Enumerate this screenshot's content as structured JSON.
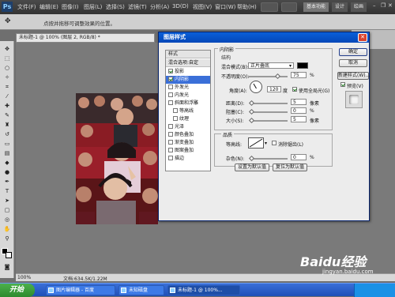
{
  "app": {
    "logo": "Ps"
  },
  "menu": [
    "文件(F)",
    "编辑(E)",
    "图像(I)",
    "图层(L)",
    "选择(S)",
    "滤镜(T)",
    "分析(A)",
    "3D(D)",
    "视图(V)",
    "窗口(W)",
    "帮助(H)"
  ],
  "workspaces": [
    "基本功能",
    "设计",
    "绘画"
  ],
  "options": {
    "hint": "点按并拖移可调整效果的位置。"
  },
  "document": {
    "tab": "未标题-1 @ 100% (图层 2, RGB/8) *",
    "zoom": "100%",
    "doc_size": "文档:634.5K/1.22M"
  },
  "dialog": {
    "title": "图层样式",
    "close_label": "✕",
    "style_list": [
      {
        "label": "样式",
        "type": "header"
      },
      {
        "label": "混合选项:自定",
        "type": "header"
      },
      {
        "label": "投影",
        "checked": true
      },
      {
        "label": "内阴影",
        "checked": true,
        "selected": true
      },
      {
        "label": "外发光",
        "checked": false
      },
      {
        "label": "内发光",
        "checked": false
      },
      {
        "label": "斜面和浮雕",
        "checked": false
      },
      {
        "label": "等高线",
        "checked": false
      },
      {
        "label": "纹理",
        "checked": false
      },
      {
        "label": "光泽",
        "checked": false
      },
      {
        "label": "颜色叠加",
        "checked": false
      },
      {
        "label": "渐变叠加",
        "checked": false
      },
      {
        "label": "图案叠加",
        "checked": false
      },
      {
        "label": "描边",
        "checked": false
      }
    ],
    "panel_title": "内阴影",
    "structure": {
      "legend": "结构",
      "blend_mode_label": "混合模式(B):",
      "blend_mode_value": "正片叠底",
      "blend_color": "#000000",
      "opacity_label": "不透明度(O):",
      "opacity_value": "75",
      "opacity_unit": "%",
      "opacity_fraction": 0.75,
      "angle_label": "角度(A):",
      "angle_value": "120",
      "angle_unit": "度",
      "global_light_label": "使用全局光(G)",
      "global_light_checked": true,
      "distance_label": "距离(D):",
      "distance_value": "5",
      "distance_unit": "像素",
      "choke_label": "阻塞(C):",
      "choke_value": "0",
      "choke_unit": "%",
      "size_label": "大小(S):",
      "size_value": "5",
      "size_unit": "像素"
    },
    "quality": {
      "legend": "品质",
      "contour_label": "等高线:",
      "antialias_label": "消除锯齿(L)",
      "antialias_checked": false,
      "noise_label": "杂色(N):",
      "noise_value": "0",
      "noise_unit": "%"
    },
    "set_default": "设置为默认值",
    "reset_default": "复位为默认值",
    "ok": "确定",
    "cancel": "取消",
    "new_style": "新建样式(W)...",
    "preview_label": "预览(V)",
    "preview_checked": true
  },
  "taskbar": {
    "start": "开始",
    "items": [
      "图片编辑器 - 百度",
      "未知磁盘",
      "未标题-1 @ 100%..."
    ],
    "active_index": 2
  },
  "watermark": {
    "brand": "Baidu经验",
    "url": "jingyan.baidu.com"
  }
}
